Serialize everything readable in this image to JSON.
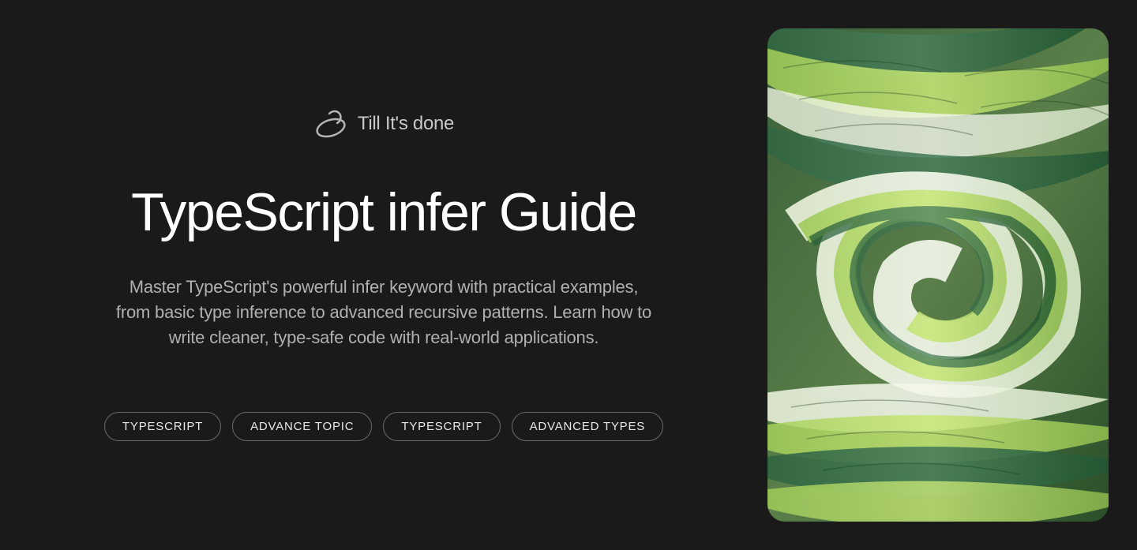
{
  "brand": {
    "text": "Till It's done"
  },
  "title": "TypeScript infer Guide",
  "description": "Master TypeScript's powerful infer keyword with practical examples, from basic type inference to advanced recursive patterns. Learn how to write cleaner, type-safe code with real-world applications.",
  "tags": [
    "TYPESCRIPT",
    "ADVANCE TOPIC",
    "TYPESCRIPT",
    "ADVANCED TYPES"
  ]
}
